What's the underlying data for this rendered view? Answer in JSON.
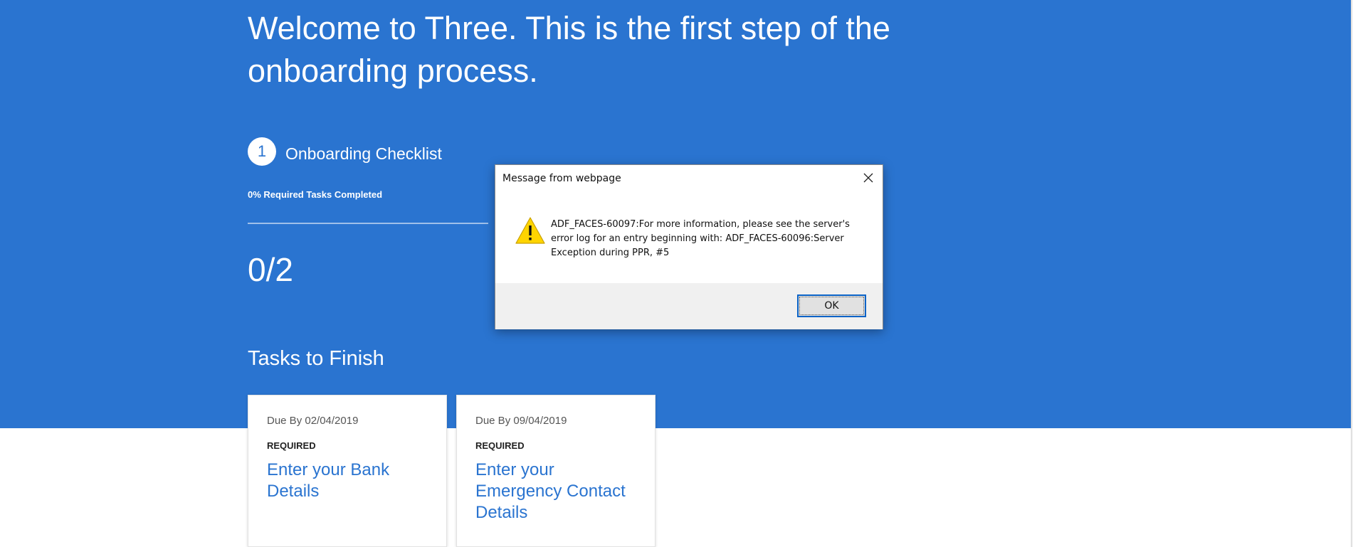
{
  "hero": {
    "welcome": "Welcome to Three. This is the first step of the onboarding process.",
    "step_number": "1",
    "step_label": "Onboarding Checklist",
    "progress_text": "0% Required Tasks Completed",
    "progress_fraction": 0,
    "count": "0/2",
    "tasks_heading": "Tasks to Finish"
  },
  "tasks": [
    {
      "due": "Due By 02/04/2019",
      "tag": "REQUIRED",
      "title": "Enter your Bank Details"
    },
    {
      "due": "Due By 09/04/2019",
      "tag": "REQUIRED",
      "title": "Enter your Emergency Contact Details"
    }
  ],
  "dialog": {
    "title": "Message from webpage",
    "message": "ADF_FACES-60097:For more information, please see the server's error log for an entry beginning with: ADF_FACES-60096:Server Exception during PPR, #5",
    "ok_label": "OK",
    "icon": "warning-icon",
    "close_icon": "close-icon"
  },
  "colors": {
    "hero_background": "#2a74d0",
    "link": "#2a74d0",
    "button_focus": "#0a63c7",
    "dialog_footer": "#f0f0f0"
  }
}
